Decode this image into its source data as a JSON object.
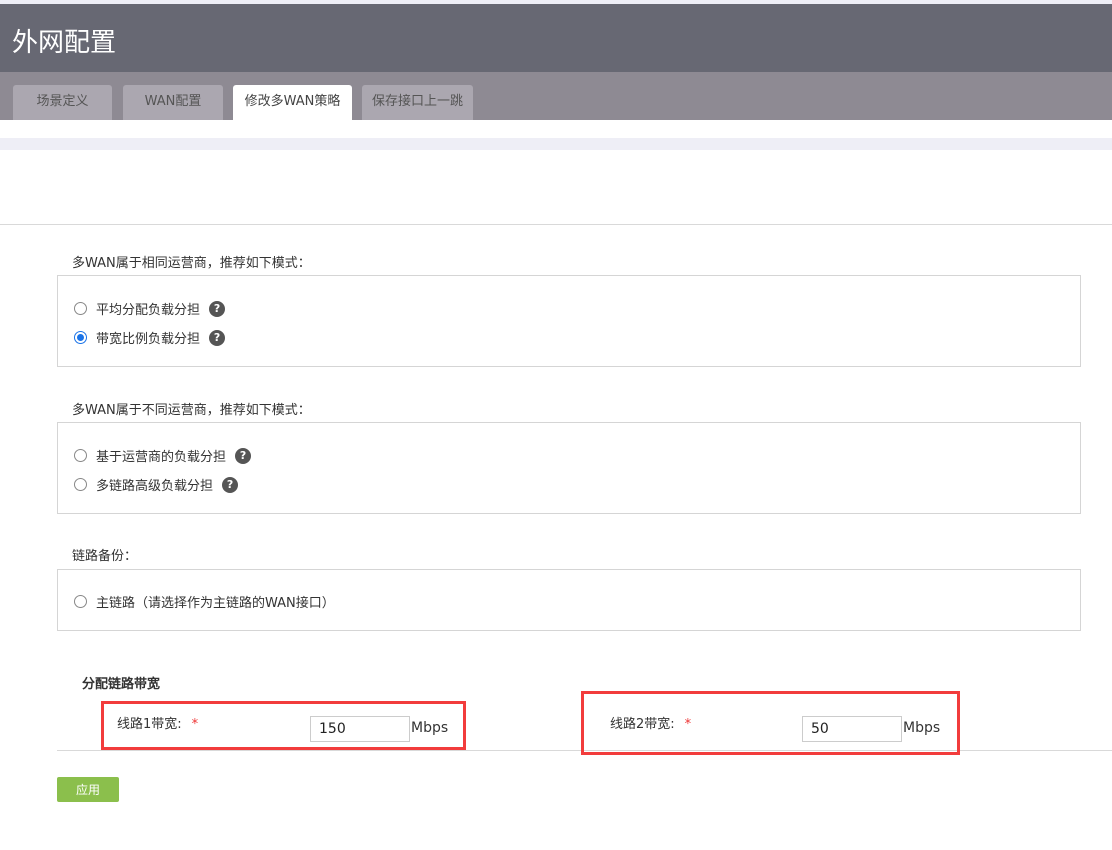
{
  "header": {
    "title": "外网配置"
  },
  "tabs": [
    {
      "label": "场景定义"
    },
    {
      "label": "WAN配置"
    },
    {
      "label": "修改多WAN策略"
    },
    {
      "label": "保存接口上一跳"
    }
  ],
  "same_isp": {
    "heading": "多WAN属于相同运营商，推荐如下模式：",
    "options": [
      {
        "label": "平均分配负载分担",
        "checked": false
      },
      {
        "label": "带宽比例负载分担",
        "checked": true
      }
    ]
  },
  "diff_isp": {
    "heading": "多WAN属于不同运营商，推荐如下模式：",
    "options": [
      {
        "label": "基于运营商的负载分担",
        "checked": false
      },
      {
        "label": "多链路高级负载分担",
        "checked": false
      }
    ]
  },
  "backup": {
    "heading": "链路备份：",
    "options": [
      {
        "label": "主链路（请选择作为主链路的WAN接口）",
        "checked": false
      }
    ]
  },
  "bandwidth": {
    "heading": "分配链路带宽",
    "line1": {
      "label": "线路1带宽:",
      "required": "*",
      "value": "150",
      "unit": "Mbps"
    },
    "line2": {
      "label": "线路2带宽:",
      "required": "*",
      "value": "50",
      "unit": "Mbps"
    }
  },
  "help_glyph": "?",
  "apply_label": "应用"
}
